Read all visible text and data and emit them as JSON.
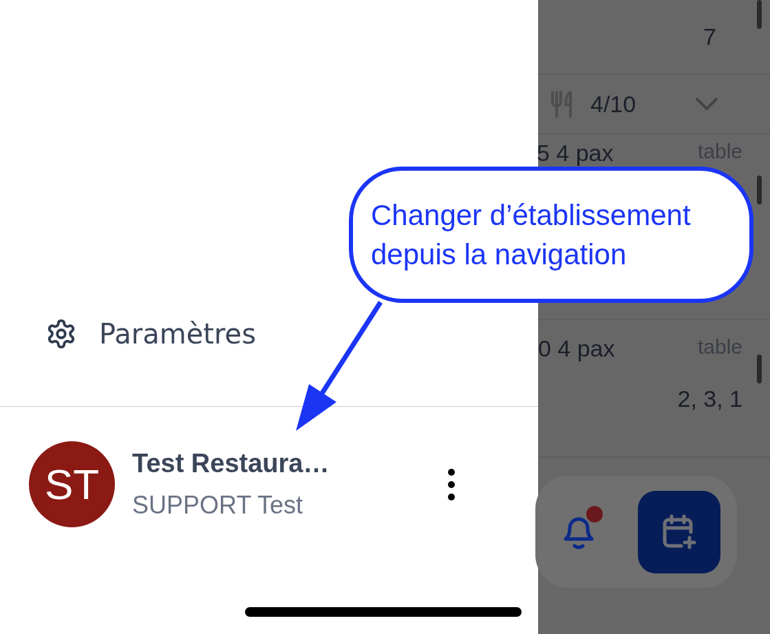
{
  "drawer": {
    "settings_item": {
      "label": "Paramètres"
    },
    "account": {
      "initials": "ST",
      "name": "Test Restaura…",
      "user": "SUPPORT Test"
    }
  },
  "background": {
    "count": "7",
    "covers": "4/10",
    "bookings": [
      {
        "time_pax": "5 4 pax",
        "label": "table"
      },
      {
        "time_pax": "0 4 pax",
        "label": "table",
        "tables": "2, 3, 1"
      }
    ],
    "notifications": {
      "unread": true
    }
  },
  "callout": {
    "text": "Changer d’établissement depuis la navigation"
  }
}
